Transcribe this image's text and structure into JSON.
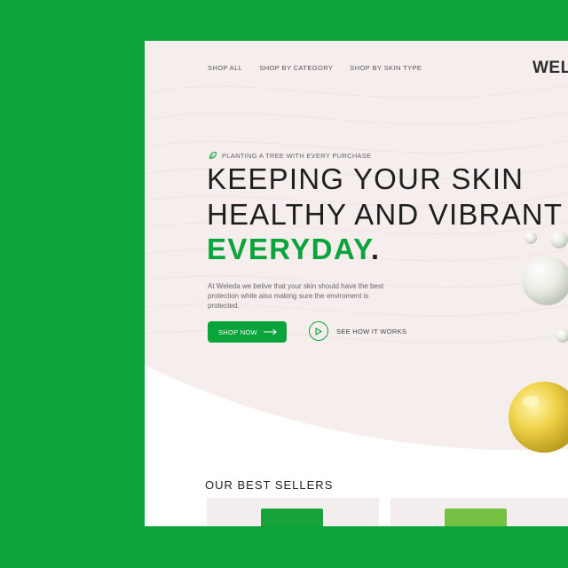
{
  "nav": {
    "items": [
      "SHOP ALL",
      "SHOP BY CATEGORY",
      "SHOP BY SKIN TYPE"
    ],
    "logo": "WELE"
  },
  "hero": {
    "tagline": "PLANTING A TREE WITH EVERY PURCHASE",
    "headline_line1": "KEEPING YOUR SKIN",
    "headline_line2": "HEALTHY AND VIBRANT",
    "headline_line3": "EVERYDAY",
    "headline_dot": ".",
    "description": "At Weleda we belive that your skin should have the best protection while also making sure the enviroment is protected.",
    "shop_button": "SHOP NOW",
    "video_link": "SEE HOW IT WORKS"
  },
  "best_sellers": {
    "title": "OUR BEST SELLERS"
  },
  "colors": {
    "brand_green": "#0aa33c",
    "hero_background": "#f5eeed",
    "card_background": "#f3eeed"
  },
  "icons": {
    "tagline": "leaf-icon",
    "shop_button": "arrow-right-icon",
    "video_link": "play-icon"
  }
}
